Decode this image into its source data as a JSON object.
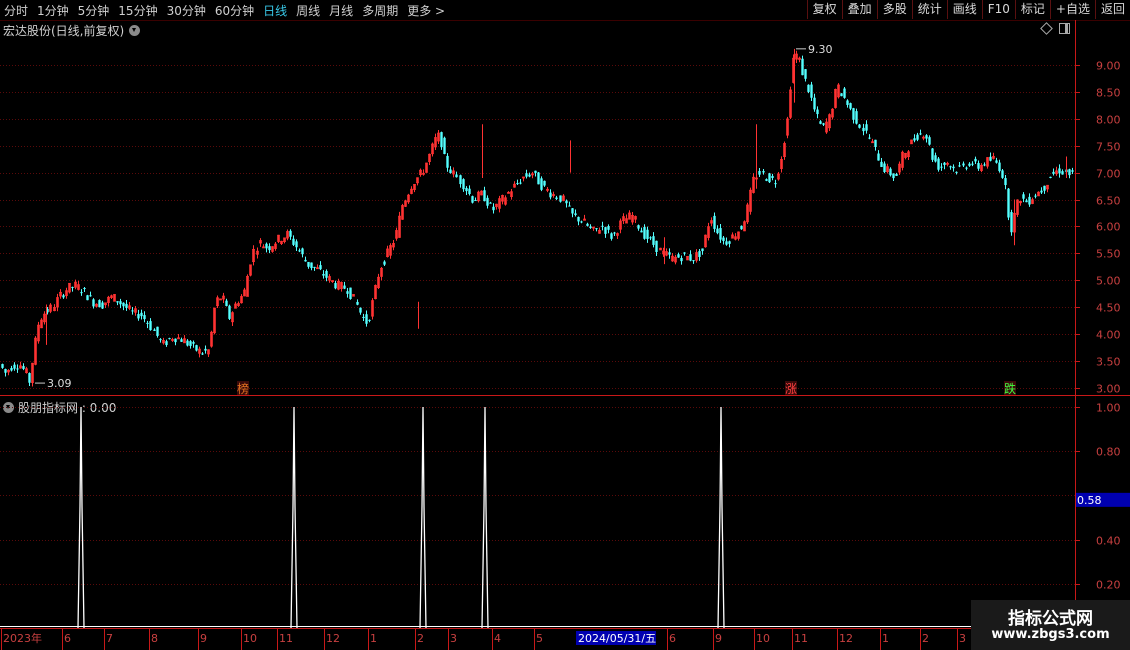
{
  "toolbar": {
    "periods": [
      {
        "label": "分时",
        "active": false
      },
      {
        "label": "1分钟",
        "active": false
      },
      {
        "label": "5分钟",
        "active": false
      },
      {
        "label": "15分钟",
        "active": false
      },
      {
        "label": "30分钟",
        "active": false
      },
      {
        "label": "60分钟",
        "active": false
      },
      {
        "label": "日线",
        "active": true
      },
      {
        "label": "周线",
        "active": false
      },
      {
        "label": "月线",
        "active": false
      },
      {
        "label": "多周期",
        "active": false
      },
      {
        "label": "更多 >",
        "active": false
      }
    ],
    "buttons": [
      "复权",
      "叠加",
      "多股",
      "统计",
      "画线",
      "F10",
      "标记",
      "+自选",
      "返回"
    ]
  },
  "chart_title": "宏达股份(日线,前复权)",
  "indicator_title": "股朋指标网 : 0.00",
  "watermark": {
    "line1": "指标公式网",
    "line2": "www.zbgs3.com"
  },
  "colors": {
    "up": "#ff3232",
    "down": "#54ffff",
    "grid": "#5a0a0a",
    "axis": "#c81818",
    "label": "#c84040",
    "cursor_bg": "#0000b0"
  },
  "chart_data": [
    {
      "type": "candlestick",
      "title": "",
      "y_ticks": [
        3.0,
        3.5,
        4.0,
        4.5,
        5.0,
        5.5,
        6.0,
        6.5,
        7.0,
        7.5,
        8.0,
        8.5,
        9.0
      ],
      "ylim": [
        2.85,
        9.65
      ],
      "annotations": [
        {
          "text": "3.09",
          "value": 3.09,
          "index": 33
        },
        {
          "text": "9.30",
          "value": 9.3,
          "index": 282
        }
      ],
      "markers": [
        {
          "text": "榜",
          "index": 85,
          "color": "#e07020"
        },
        {
          "text": "涨",
          "index": 282,
          "color": "#ff4040"
        },
        {
          "text": "跌",
          "index": 360,
          "color": "#40ff40"
        }
      ],
      "price_path": [
        [
          0,
          3.5
        ],
        [
          8,
          3.28
        ],
        [
          14,
          3.4
        ],
        [
          22,
          3.45
        ],
        [
          30,
          3.25
        ],
        [
          33,
          3.09
        ],
        [
          36,
          3.6
        ],
        [
          42,
          4.25
        ],
        [
          48,
          4.4
        ],
        [
          55,
          4.5
        ],
        [
          62,
          4.7
        ],
        [
          70,
          4.85
        ],
        [
          78,
          4.9
        ],
        [
          86,
          4.8
        ],
        [
          95,
          4.6
        ],
        [
          105,
          4.55
        ],
        [
          115,
          4.7
        ],
        [
          125,
          4.55
        ],
        [
          135,
          4.4
        ],
        [
          145,
          4.35
        ],
        [
          155,
          4.1
        ],
        [
          165,
          3.8
        ],
        [
          175,
          3.95
        ],
        [
          185,
          3.9
        ],
        [
          195,
          3.75
        ],
        [
          205,
          3.65
        ],
        [
          212,
          3.7
        ],
        [
          218,
          4.6
        ],
        [
          225,
          4.7
        ],
        [
          232,
          4.3
        ],
        [
          240,
          4.6
        ],
        [
          247,
          4.75
        ],
        [
          255,
          5.5
        ],
        [
          262,
          5.7
        ],
        [
          270,
          5.6
        ],
        [
          280,
          5.75
        ],
        [
          290,
          5.85
        ],
        [
          300,
          5.6
        ],
        [
          310,
          5.3
        ],
        [
          320,
          5.2
        ],
        [
          330,
          5.05
        ],
        [
          340,
          4.9
        ],
        [
          350,
          4.85
        ],
        [
          358,
          4.6
        ],
        [
          365,
          4.3
        ],
        [
          370,
          4.2
        ],
        [
          375,
          4.6
        ],
        [
          382,
          5.2
        ],
        [
          390,
          5.5
        ],
        [
          398,
          5.8
        ],
        [
          405,
          6.4
        ],
        [
          415,
          6.8
        ],
        [
          425,
          7.0
        ],
        [
          432,
          7.3
        ],
        [
          438,
          7.6
        ],
        [
          443,
          7.7
        ],
        [
          448,
          7.2
        ],
        [
          455,
          7.0
        ],
        [
          465,
          6.8
        ],
        [
          475,
          6.5
        ],
        [
          485,
          6.6
        ],
        [
          495,
          6.3
        ],
        [
          505,
          6.5
        ],
        [
          515,
          6.7
        ],
        [
          525,
          6.9
        ],
        [
          535,
          7.0
        ],
        [
          545,
          6.75
        ],
        [
          555,
          6.6
        ],
        [
          565,
          6.5
        ],
        [
          575,
          6.2
        ],
        [
          585,
          6.1
        ],
        [
          595,
          5.9
        ],
        [
          605,
          6.0
        ],
        [
          615,
          5.8
        ],
        [
          625,
          6.1
        ],
        [
          635,
          6.2
        ],
        [
          645,
          5.9
        ],
        [
          655,
          5.7
        ],
        [
          665,
          5.5
        ],
        [
          675,
          5.4
        ],
        [
          685,
          5.45
        ],
        [
          695,
          5.4
        ],
        [
          705,
          5.55
        ],
        [
          713,
          6.2
        ],
        [
          720,
          5.9
        ],
        [
          727,
          5.7
        ],
        [
          735,
          5.8
        ],
        [
          745,
          6.0
        ],
        [
          750,
          6.3
        ],
        [
          757,
          6.9
        ],
        [
          762,
          7.0
        ],
        [
          770,
          6.9
        ],
        [
          778,
          6.85
        ],
        [
          785,
          7.4
        ],
        [
          790,
          8.0
        ],
        [
          795,
          9.1
        ],
        [
          800,
          9.2
        ],
        [
          806,
          8.8
        ],
        [
          812,
          8.5
        ],
        [
          818,
          8.1
        ],
        [
          825,
          7.8
        ],
        [
          832,
          8.0
        ],
        [
          840,
          8.6
        ],
        [
          847,
          8.4
        ],
        [
          855,
          8.1
        ],
        [
          862,
          7.9
        ],
        [
          870,
          7.7
        ],
        [
          878,
          7.4
        ],
        [
          885,
          7.1
        ],
        [
          892,
          7.0
        ],
        [
          898,
          6.9
        ],
        [
          905,
          7.3
        ],
        [
          912,
          7.5
        ],
        [
          920,
          7.7
        ],
        [
          928,
          7.75
        ],
        [
          935,
          7.3
        ],
        [
          942,
          7.1
        ],
        [
          950,
          7.2
        ],
        [
          958,
          7.05
        ],
        [
          965,
          7.1
        ],
        [
          972,
          7.2
        ],
        [
          980,
          7.1
        ],
        [
          988,
          7.2
        ],
        [
          996,
          7.25
        ],
        [
          1004,
          7.05
        ],
        [
          1009,
          6.6
        ],
        [
          1013,
          5.9
        ],
        [
          1017,
          6.2
        ],
        [
          1022,
          6.55
        ],
        [
          1030,
          6.45
        ],
        [
          1038,
          6.6
        ],
        [
          1046,
          6.7
        ],
        [
          1054,
          6.95
        ],
        [
          1062,
          7.05
        ],
        [
          1068,
          7.0
        ],
        [
          1074,
          6.95
        ]
      ],
      "spikes": [
        {
          "x": 794,
          "high": 9.3,
          "low": 8.3
        },
        {
          "x": 46,
          "high": 4.55,
          "low": 3.8
        },
        {
          "x": 482,
          "high": 7.9,
          "low": 6.9
        },
        {
          "x": 570,
          "high": 7.6,
          "low": 7.0
        },
        {
          "x": 1014,
          "high": 6.5,
          "low": 5.65
        },
        {
          "x": 664,
          "high": 5.8,
          "low": 5.3
        },
        {
          "x": 418,
          "high": 4.6,
          "low": 4.1
        },
        {
          "x": 756,
          "high": 7.9,
          "low": 6.7
        },
        {
          "x": 1066,
          "high": 7.3,
          "low": 6.9
        }
      ]
    },
    {
      "type": "line",
      "title": "股朋指标网",
      "y_ticks": [
        0.2,
        0.4,
        0.6,
        0.8,
        1.0
      ],
      "ylim": [
        0.0,
        1.05
      ],
      "cursor_value": "0.58",
      "spikes": [
        {
          "x": 81,
          "value": 1.0
        },
        {
          "x": 294,
          "value": 1.0
        },
        {
          "x": 423,
          "value": 1.0
        },
        {
          "x": 485,
          "value": 1.0
        },
        {
          "x": 721,
          "value": 1.0
        }
      ]
    }
  ],
  "x_axis": {
    "labels": [
      {
        "text": "2023年",
        "x": 2
      },
      {
        "text": "6",
        "x": 63
      },
      {
        "text": "7",
        "x": 105
      },
      {
        "text": "8",
        "x": 150
      },
      {
        "text": "9",
        "x": 199
      },
      {
        "text": "10",
        "x": 242
      },
      {
        "text": "11",
        "x": 278
      },
      {
        "text": "12",
        "x": 325
      },
      {
        "text": "1",
        "x": 369
      },
      {
        "text": "2",
        "x": 416
      },
      {
        "text": "3",
        "x": 449
      },
      {
        "text": "4",
        "x": 493
      },
      {
        "text": "5",
        "x": 535
      },
      {
        "text": "6",
        "x": 668
      },
      {
        "text": "9",
        "x": 714
      },
      {
        "text": "10",
        "x": 755
      },
      {
        "text": "11",
        "x": 793
      },
      {
        "text": "12",
        "x": 838
      },
      {
        "text": "1",
        "x": 881
      },
      {
        "text": "2",
        "x": 921
      },
      {
        "text": "3",
        "x": 958
      }
    ],
    "cursor_date": "2024/05/31/五"
  }
}
